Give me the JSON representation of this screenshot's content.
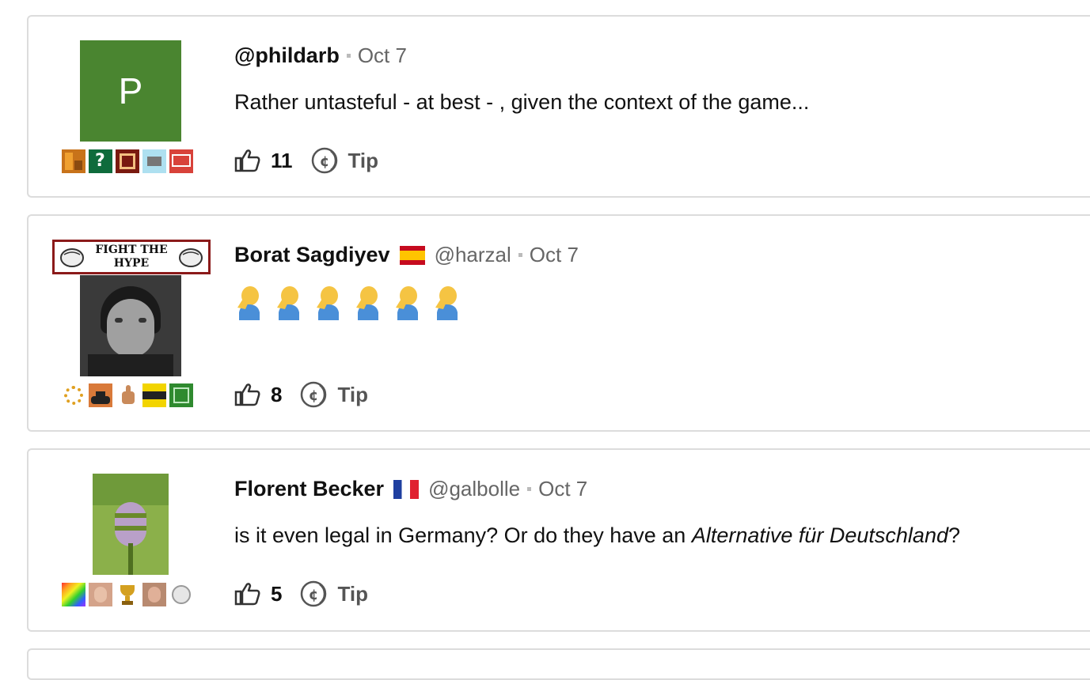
{
  "comments": [
    {
      "display_name": "",
      "handle": "@phildarb",
      "date": "Oct 7",
      "avatar_letter": "P",
      "avatar_color": "#4a8530",
      "body": "Rather untasteful - at best - , given the context of the game...",
      "likes": "11",
      "tip_label": "Tip",
      "badges": [
        "orange-tiles-badge",
        "green-question-badge",
        "red-r-badge",
        "blue-box-badge",
        "red-text-badge"
      ]
    },
    {
      "display_name": "Borat Sagdiyev",
      "handle": "@harzal",
      "date": "Oct 7",
      "flag": "spain-flag",
      "banner_text": "FIGHT THE HYPE",
      "emoji_count_label": "facepalm x6",
      "likes": "8",
      "tip_label": "Tip",
      "badges": [
        "gold-wreath-badge",
        "tank-badge",
        "thumbs-up-badge",
        "win-play-lose-badge",
        "green-f-badge"
      ]
    },
    {
      "display_name": "Florent Becker",
      "handle": "@galbolle",
      "date": "Oct 7",
      "flag": "france-flag",
      "body_prefix": "is it even legal in Germany? Or do they have an ",
      "body_italic": "Alternative für Deutschland",
      "body_suffix": "?",
      "likes": "5",
      "tip_label": "Tip",
      "badges": [
        "rainbow-badge",
        "face-badge",
        "trophy-badge",
        "portrait-badge",
        "coin-badge"
      ]
    }
  ],
  "colors": {
    "border": "#dcdcdc",
    "muted_text": "#666666",
    "avatar_green": "#4a8530"
  }
}
